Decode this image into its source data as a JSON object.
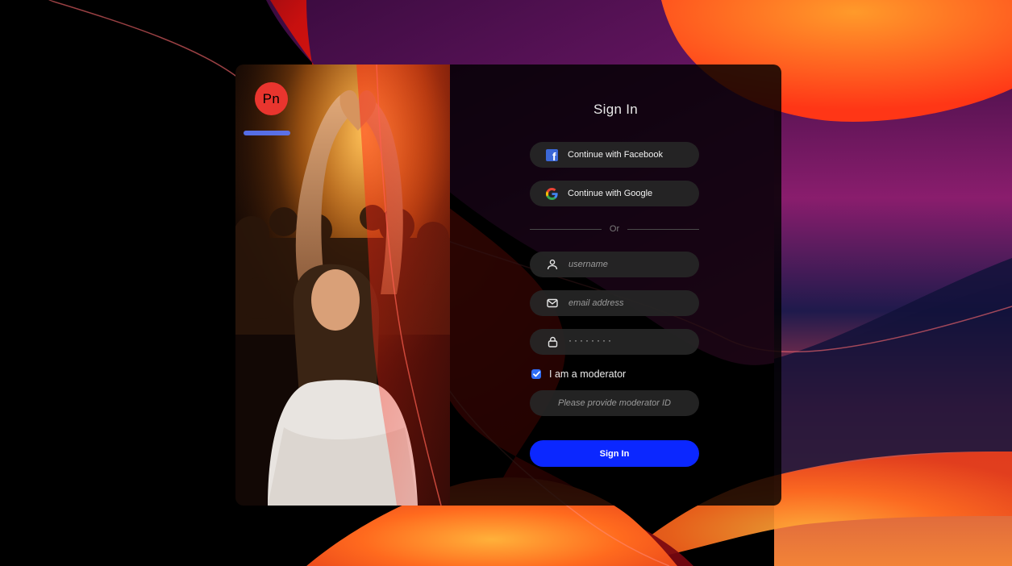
{
  "logo": {
    "text": "Pn",
    "color": "#e9352e"
  },
  "form": {
    "title": "Sign In",
    "facebook_label": "Continue with Facebook",
    "google_label": "Continue with Google",
    "divider_text": "Or",
    "username": {
      "placeholder": "username",
      "value": "",
      "icon": "user-icon"
    },
    "email": {
      "placeholder": "email address",
      "value": "",
      "icon": "mail-icon"
    },
    "password": {
      "display": "········",
      "icon": "lock-icon"
    },
    "moderator": {
      "checked": true,
      "label": "I am a moderator"
    },
    "moderator_id": {
      "placeholder": "Please provide moderator ID",
      "value": ""
    },
    "submit_label": "Sign In"
  },
  "colors": {
    "primary_button": "#0b27ff",
    "checkbox": "#2f6df5",
    "facebook": "#3b67d6",
    "accent_red": "#ff1e10",
    "accent_orange": "#ff7a1f"
  }
}
